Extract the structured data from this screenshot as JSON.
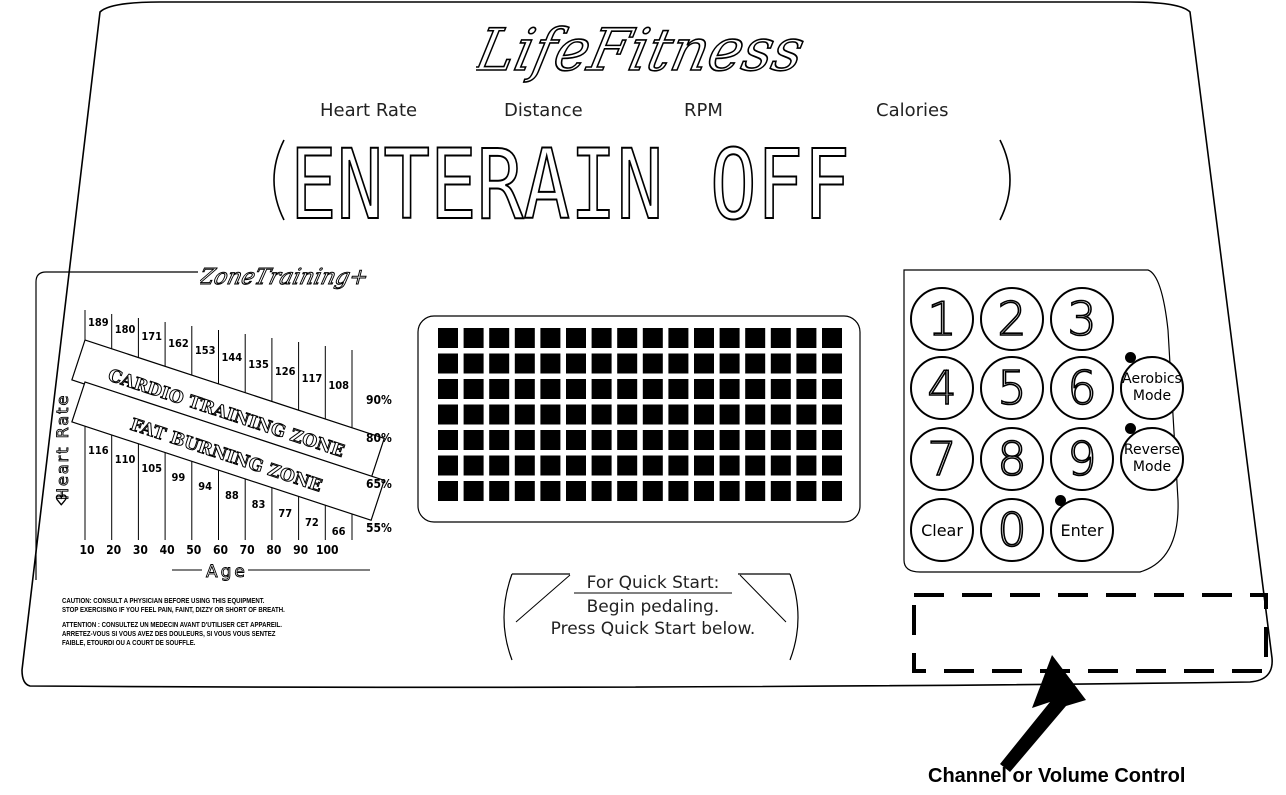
{
  "brand": {
    "name": "LifeFitness"
  },
  "metrics": [
    {
      "label": "Heart Rate"
    },
    {
      "label": "Distance"
    },
    {
      "label": "RPM"
    },
    {
      "label": "Calories"
    }
  ],
  "display": {
    "text": "ENTERAIN  OFF"
  },
  "zone_training": {
    "logo": "ZoneTraining+",
    "y_axis_label": "Heart Rate",
    "x_axis_label": "Age",
    "cardio_zone_label": "CARDIO TRAINING ZONE",
    "fat_zone_label": "FAT BURNING ZONE",
    "upper_rates": [
      "189",
      "180",
      "171",
      "162",
      "153",
      "144",
      "135",
      "126",
      "117",
      "108"
    ],
    "lower_rates": [
      "116",
      "110",
      "105",
      "99",
      "94",
      "88",
      "83",
      "77",
      "72",
      "66"
    ],
    "ages": [
      "10",
      "20",
      "30",
      "40",
      "50",
      "60",
      "70",
      "80",
      "90",
      "100"
    ],
    "percents": [
      "90%",
      "80%",
      "65%",
      "55%"
    ]
  },
  "caution": {
    "en_line1": "CAUTION: CONSULT A PHYSICIAN BEFORE USING THIS EQUIPMENT.",
    "en_line2": "STOP EXERCISING IF YOU FEEL PAIN, FAINT, DIZZY OR SHORT OF BREATH.",
    "fr_line1": "ATTENTION : CONSULTEZ UN MEDECIN AVANT D'UTILISER CET APPAREIL.",
    "fr_line2": "ARRETEZ-VOUS SI VOUS AVEZ DES DOULEURS, SI VOUS VOUS SENTEZ",
    "fr_line3": "FAIBLE, ETOURDI OU A COURT DE SOUFFLE."
  },
  "matrix": {
    "cols": 16,
    "rows": 7
  },
  "quick_start": {
    "title": "For Quick Start:",
    "line1": "Begin pedaling.",
    "line2": "Press Quick Start below."
  },
  "keypad": {
    "k1": "1",
    "k2": "2",
    "k3": "3",
    "k4": "4",
    "k5": "5",
    "k6": "6",
    "k7": "7",
    "k8": "8",
    "k9": "9",
    "clear": "Clear",
    "k0": "0",
    "enter": "Enter",
    "aerobics_line1": "Aerobics",
    "aerobics_line2": "Mode",
    "reverse_line1": "Reverse",
    "reverse_line2": "Mode"
  },
  "callout": {
    "label": "Channel or Volume Control"
  }
}
